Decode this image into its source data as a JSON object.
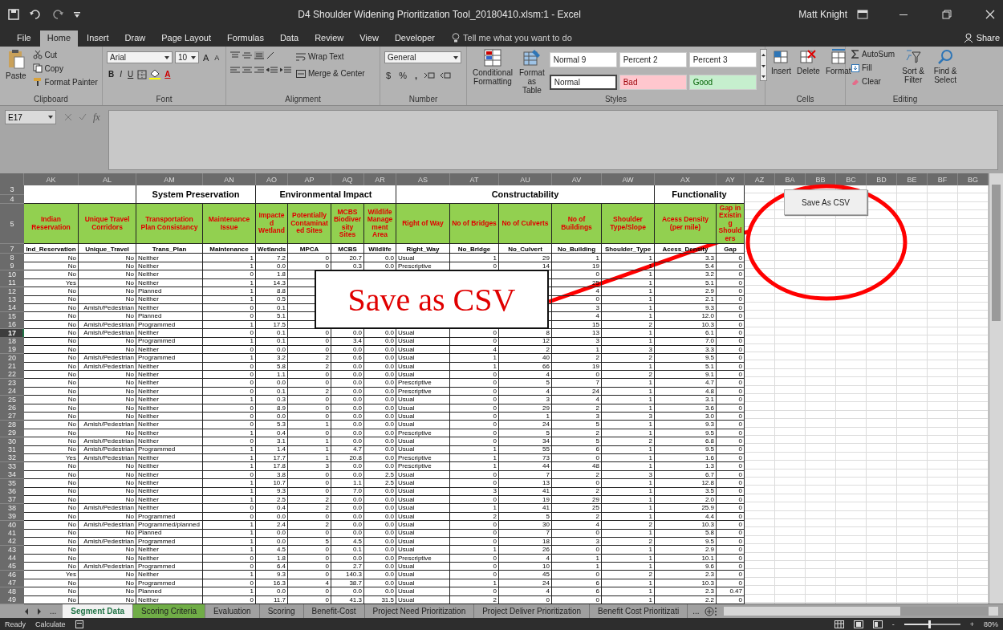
{
  "window": {
    "title": "D4 Shoulder Widening Prioritization Tool_20180410.xlsm:1  -  Excel",
    "user": "Matt Knight"
  },
  "ribbon_tabs": [
    {
      "label": "File",
      "selected": false
    },
    {
      "label": "Home",
      "selected": true
    },
    {
      "label": "Insert",
      "selected": false
    },
    {
      "label": "Draw",
      "selected": false
    },
    {
      "label": "Page Layout",
      "selected": false
    },
    {
      "label": "Formulas",
      "selected": false
    },
    {
      "label": "Data",
      "selected": false
    },
    {
      "label": "Review",
      "selected": false
    },
    {
      "label": "View",
      "selected": false
    },
    {
      "label": "Developer",
      "selected": false
    }
  ],
  "tell_me": {
    "placeholder": "Tell me what you want to do"
  },
  "share": "Share",
  "ribbon": {
    "clipboard": {
      "label": "Clipboard",
      "paste": "Paste",
      "cut": "Cut",
      "copy": "Copy",
      "format_painter": "Format Painter"
    },
    "font": {
      "label": "Font",
      "family": "Arial",
      "size": "10",
      "grow": "A",
      "shrink": "A",
      "bold": "B",
      "italic": "I",
      "underline": "U",
      "font_color_button": "A"
    },
    "alignment": {
      "label": "Alignment",
      "wrap_text": "Wrap Text",
      "merge_center": "Merge & Center"
    },
    "number": {
      "label": "Number",
      "format": "General",
      "currency": "$",
      "percent": "%",
      "comma": ","
    },
    "styles": {
      "label": "Styles",
      "conditional": "Conditional Formatting",
      "format_table": "Format as Table",
      "cells": [
        {
          "label": "Normal 9",
          "kind": "plain",
          "selected": false
        },
        {
          "label": "Percent 2",
          "kind": "plain",
          "selected": false
        },
        {
          "label": "Percent 3",
          "kind": "plain",
          "selected": false
        },
        {
          "label": "Normal",
          "kind": "plain",
          "selected": true
        },
        {
          "label": "Bad",
          "kind": "bad",
          "selected": false
        },
        {
          "label": "Good",
          "kind": "good",
          "selected": false
        }
      ]
    },
    "cells": {
      "label": "Cells",
      "insert": "Insert",
      "delete": "Delete",
      "format": "Format"
    },
    "editing": {
      "label": "Editing",
      "autosum": "AutoSum",
      "fill": "Fill",
      "clear": "Clear",
      "sort_filter": "Sort & Filter",
      "find_select": "Find & Select"
    }
  },
  "formula_bar": {
    "name_box": "E17",
    "function_label": "fx"
  },
  "sheet": {
    "column_letters": [
      "AK",
      "AL",
      "AM",
      "AN",
      "AO",
      "AP",
      "AQ",
      "AR",
      "AS",
      "AT",
      "AU",
      "AV",
      "AW",
      "AX",
      "AY",
      "AZ",
      "BA",
      "BB",
      "BC",
      "BD",
      "BE",
      "BF",
      "BG"
    ],
    "group_row_numbers": [
      "3",
      "4"
    ],
    "header_row_number": "5",
    "field_row_number": "7",
    "column_groups": [
      {
        "columns": [
          {
            "title": "Indian Reservation",
            "field": "Ind_Reservation"
          },
          {
            "title": "Unique Travel Corridors",
            "field": "Unique_Travel"
          }
        ]
      },
      {
        "label": "System Preservation",
        "columns": [
          {
            "title": "Transportation Plan Consistancy",
            "field": "Trans_Plan"
          },
          {
            "title": "Maintenance Issue",
            "field": "Maintenance"
          }
        ]
      },
      {
        "label": "Environmental Impact",
        "columns": [
          {
            "title": "Impacted Wetland",
            "field": "Wetlands"
          },
          {
            "title": "Potentially Contaminated Sites",
            "field": "MPCA"
          },
          {
            "title": "MCBS Biodiversity Sites",
            "field": "MCBS"
          },
          {
            "title": "Wildlife Management Area",
            "field": "Wildlife"
          }
        ]
      },
      {
        "label": "Constructability",
        "columns": [
          {
            "title": "Right of Way",
            "field": "Right_Way"
          },
          {
            "title": "No of Bridges",
            "field": "No_Bridge"
          },
          {
            "title": "No of Culverts",
            "field": "No_Culvert"
          },
          {
            "title": "No of Buildings",
            "field": "No_Building"
          },
          {
            "title": "Shoulder Type/Slope",
            "field": "Shoulder_Type"
          }
        ]
      },
      {
        "label": "Functionality",
        "columns": [
          {
            "title": "Acess Density (per mile)",
            "field": "Acess_Density"
          },
          {
            "title": "Gap in Existing Shoulders",
            "field": "Gap"
          }
        ]
      }
    ],
    "rows": [
      {
        "number": "8",
        "selected": false,
        "cells": [
          "No",
          "No",
          "Neither",
          "1",
          "7.2",
          "0",
          "20.7",
          "0.0",
          "Usual",
          "1",
          "29",
          "1",
          "1",
          "3.3",
          "0"
        ]
      },
      {
        "number": "9",
        "selected": false,
        "cells": [
          "No",
          "No",
          "Neither",
          "1",
          "0.0",
          "0",
          "0.3",
          "0.0",
          "Prescriptive",
          "0",
          "14",
          "19",
          "1",
          "5.4",
          "0"
        ]
      },
      {
        "number": "10",
        "selected": false,
        "cells": [
          "No",
          "No",
          "Neither",
          "0",
          "1.8",
          null,
          null,
          null,
          null,
          null,
          null,
          "0",
          "1",
          "3.2",
          "0"
        ]
      },
      {
        "number": "11",
        "selected": false,
        "cells": [
          "Yes",
          "No",
          "Neither",
          "1",
          "14.3",
          null,
          null,
          null,
          null,
          null,
          null,
          "25",
          "1",
          "5.1",
          "0"
        ]
      },
      {
        "number": "12",
        "selected": false,
        "cells": [
          "No",
          "No",
          "Planned",
          "1",
          "8.8",
          null,
          null,
          null,
          null,
          null,
          null,
          "4",
          "1",
          "2.9",
          "0"
        ]
      },
      {
        "number": "13",
        "selected": false,
        "cells": [
          "No",
          "No",
          "Neither",
          "1",
          "0.5",
          null,
          null,
          null,
          null,
          null,
          null,
          "0",
          "1",
          "2.1",
          "0"
        ]
      },
      {
        "number": "14",
        "selected": false,
        "cells": [
          "No",
          "Amish/Pedestrian",
          "Neither",
          "0",
          "0.1",
          null,
          null,
          null,
          null,
          null,
          null,
          "3",
          "1",
          "9.3",
          "0"
        ]
      },
      {
        "number": "15",
        "selected": false,
        "cells": [
          "No",
          "No",
          "Planned",
          "0",
          "5.1",
          null,
          null,
          null,
          null,
          null,
          null,
          "4",
          "1",
          "12.0",
          "0"
        ]
      },
      {
        "number": "16",
        "selected": false,
        "cells": [
          "No",
          "Amish/Pedestrian",
          "Programmed",
          "1",
          "17.5",
          null,
          null,
          null,
          null,
          null,
          null,
          "15",
          "2",
          "10.3",
          "0"
        ]
      },
      {
        "number": "17",
        "selected": true,
        "cells": [
          "No",
          "Amish/Pedestrian",
          "Neither",
          "0",
          "0.1",
          "0",
          "0.0",
          "0.0",
          "Usual",
          "0",
          "8",
          "13",
          "1",
          "6.1",
          "0"
        ]
      },
      {
        "number": "18",
        "selected": false,
        "cells": [
          "No",
          "No",
          "Programmed",
          "1",
          "0.1",
          "0",
          "3.4",
          "0.0",
          "Usual",
          "0",
          "12",
          "3",
          "1",
          "7.0",
          "0"
        ]
      },
      {
        "number": "19",
        "selected": false,
        "cells": [
          "No",
          "No",
          "Neither",
          "0",
          "0.0",
          "0",
          "0.0",
          "0.0",
          "Usual",
          "4",
          "2",
          "1",
          "3",
          "3.3",
          "0"
        ]
      },
      {
        "number": "20",
        "selected": false,
        "cells": [
          "No",
          "Amish/Pedestrian",
          "Programmed",
          "1",
          "3.2",
          "2",
          "0.6",
          "0.0",
          "Usual",
          "1",
          "40",
          "2",
          "2",
          "9.5",
          "0"
        ]
      },
      {
        "number": "21",
        "selected": false,
        "cells": [
          "No",
          "Amish/Pedestrian",
          "Neither",
          "0",
          "5.8",
          "2",
          "0.0",
          "0.0",
          "Usual",
          "1",
          "66",
          "19",
          "1",
          "5.1",
          "0"
        ]
      },
      {
        "number": "22",
        "selected": false,
        "cells": [
          "No",
          "No",
          "Neither",
          "0",
          "1.1",
          "0",
          "0.0",
          "0.0",
          "Usual",
          "0",
          "4",
          "0",
          "2",
          "9.1",
          "0"
        ]
      },
      {
        "number": "23",
        "selected": false,
        "cells": [
          "No",
          "No",
          "Neither",
          "0",
          "0.0",
          "0",
          "0.0",
          "0.0",
          "Prescriptive",
          "0",
          "5",
          "7",
          "1",
          "4.7",
          "0"
        ]
      },
      {
        "number": "24",
        "selected": false,
        "cells": [
          "No",
          "No",
          "Neither",
          "0",
          "0.1",
          "2",
          "0.0",
          "0.0",
          "Prescriptive",
          "0",
          "4",
          "24",
          "1",
          "4.8",
          "0"
        ]
      },
      {
        "number": "25",
        "selected": false,
        "cells": [
          "No",
          "No",
          "Neither",
          "1",
          "0.3",
          "0",
          "0.0",
          "0.0",
          "Usual",
          "0",
          "3",
          "4",
          "1",
          "3.1",
          "0"
        ]
      },
      {
        "number": "26",
        "selected": false,
        "cells": [
          "No",
          "No",
          "Neither",
          "0",
          "8.9",
          "0",
          "0.0",
          "0.0",
          "Usual",
          "0",
          "29",
          "2",
          "1",
          "3.6",
          "0"
        ]
      },
      {
        "number": "27",
        "selected": false,
        "cells": [
          "No",
          "No",
          "Neither",
          "0",
          "0.0",
          "0",
          "0.0",
          "0.0",
          "Usual",
          "0",
          "1",
          "3",
          "3",
          "3.0",
          "0"
        ]
      },
      {
        "number": "28",
        "selected": false,
        "cells": [
          "No",
          "Amish/Pedestrian",
          "Neither",
          "0",
          "5.3",
          "1",
          "0.0",
          "0.0",
          "Usual",
          "0",
          "24",
          "5",
          "1",
          "9.3",
          "0"
        ]
      },
      {
        "number": "29",
        "selected": false,
        "cells": [
          "No",
          "No",
          "Neither",
          "1",
          "0.4",
          "0",
          "0.0",
          "0.0",
          "Prescriptive",
          "0",
          "5",
          "2",
          "1",
          "9.5",
          "0"
        ]
      },
      {
        "number": "30",
        "selected": false,
        "cells": [
          "No",
          "Amish/Pedestrian",
          "Neither",
          "0",
          "3.1",
          "1",
          "0.0",
          "0.0",
          "Usual",
          "0",
          "34",
          "5",
          "2",
          "6.8",
          "0"
        ]
      },
      {
        "number": "31",
        "selected": false,
        "cells": [
          "No",
          "Amish/Pedestrian",
          "Programmed",
          "1",
          "1.4",
          "1",
          "4.7",
          "0.0",
          "Usual",
          "1",
          "55",
          "6",
          "1",
          "9.5",
          "0"
        ]
      },
      {
        "number": "32",
        "selected": false,
        "cells": [
          "Yes",
          "Amish/Pedestrian",
          "Neither",
          "1",
          "17.7",
          "1",
          "20.8",
          "0.0",
          "Prescriptive",
          "1",
          "73",
          "0",
          "1",
          "1.6",
          "0"
        ]
      },
      {
        "number": "33",
        "selected": false,
        "cells": [
          "No",
          "No",
          "Neither",
          "1",
          "17.8",
          "3",
          "0.0",
          "0.0",
          "Prescriptive",
          "1",
          "44",
          "48",
          "1",
          "1.3",
          "0"
        ]
      },
      {
        "number": "34",
        "selected": false,
        "cells": [
          "No",
          "No",
          "Neither",
          "0",
          "3.8",
          "0",
          "0.0",
          "2.5",
          "Usual",
          "0",
          "7",
          "2",
          "3",
          "6.7",
          "0"
        ]
      },
      {
        "number": "35",
        "selected": false,
        "cells": [
          "No",
          "No",
          "Neither",
          "1",
          "10.7",
          "0",
          "1.1",
          "2.5",
          "Usual",
          "0",
          "13",
          "0",
          "1",
          "12.8",
          "0"
        ]
      },
      {
        "number": "36",
        "selected": false,
        "cells": [
          "No",
          "No",
          "Neither",
          "1",
          "9.3",
          "0",
          "7.0",
          "0.0",
          "Usual",
          "3",
          "41",
          "2",
          "1",
          "3.5",
          "0"
        ]
      },
      {
        "number": "37",
        "selected": false,
        "cells": [
          "No",
          "No",
          "Neither",
          "1",
          "2.5",
          "2",
          "0.0",
          "0.0",
          "Usual",
          "0",
          "19",
          "29",
          "1",
          "2.0",
          "0"
        ]
      },
      {
        "number": "38",
        "selected": false,
        "cells": [
          "No",
          "Amish/Pedestrian",
          "Neither",
          "0",
          "0.4",
          "2",
          "0.0",
          "0.0",
          "Usual",
          "1",
          "41",
          "25",
          "1",
          "25.9",
          "0"
        ]
      },
      {
        "number": "39",
        "selected": false,
        "cells": [
          "No",
          "No",
          "Programmed",
          "0",
          "0.0",
          "0",
          "0.0",
          "0.0",
          "Usual",
          "2",
          "5",
          "2",
          "1",
          "4.4",
          "0"
        ]
      },
      {
        "number": "40",
        "selected": false,
        "cells": [
          "No",
          "Amish/Pedestrian",
          "Programmed/planned",
          "1",
          "2.4",
          "2",
          "0.0",
          "0.0",
          "Usual",
          "0",
          "30",
          "4",
          "2",
          "10.3",
          "0"
        ]
      },
      {
        "number": "41",
        "selected": false,
        "cells": [
          "No",
          "No",
          "Planned",
          "1",
          "0.0",
          "0",
          "0.0",
          "0.0",
          "Usual",
          "0",
          "7",
          "0",
          "1",
          "5.8",
          "0"
        ]
      },
      {
        "number": "42",
        "selected": false,
        "cells": [
          "No",
          "Amish/Pedestrian",
          "Programmed",
          "1",
          "0.0",
          "5",
          "4.5",
          "0.0",
          "Usual",
          "0",
          "18",
          "3",
          "2",
          "9.5",
          "0"
        ]
      },
      {
        "number": "43",
        "selected": false,
        "cells": [
          "No",
          "No",
          "Neither",
          "1",
          "4.5",
          "0",
          "0.1",
          "0.0",
          "Usual",
          "1",
          "26",
          "0",
          "1",
          "2.9",
          "0"
        ]
      },
      {
        "number": "44",
        "selected": false,
        "cells": [
          "No",
          "No",
          "Neither",
          "0",
          "1.8",
          "0",
          "0.0",
          "0.0",
          "Prescriptive",
          "0",
          "4",
          "1",
          "1",
          "10.1",
          "0"
        ]
      },
      {
        "number": "45",
        "selected": false,
        "cells": [
          "No",
          "Amish/Pedestrian",
          "Programmed",
          "0",
          "6.4",
          "0",
          "2.7",
          "0.0",
          "Usual",
          "0",
          "10",
          "1",
          "1",
          "9.6",
          "0"
        ]
      },
      {
        "number": "46",
        "selected": false,
        "cells": [
          "Yes",
          "No",
          "Neither",
          "1",
          "9.3",
          "0",
          "140.3",
          "0.0",
          "Usual",
          "0",
          "45",
          "0",
          "2",
          "2.3",
          "0"
        ]
      },
      {
        "number": "47",
        "selected": false,
        "cells": [
          "No",
          "No",
          "Programmed",
          "0",
          "16.3",
          "4",
          "38.7",
          "0.0",
          "Usual",
          "1",
          "24",
          "6",
          "1",
          "10.3",
          "0"
        ]
      },
      {
        "number": "48",
        "selected": false,
        "cells": [
          "No",
          "No",
          "Planned",
          "1",
          "0.0",
          "0",
          "0.0",
          "0.0",
          "Usual",
          "0",
          "4",
          "6",
          "1",
          "2.3",
          "0.47"
        ]
      },
      {
        "number": "49",
        "selected": false,
        "cells": [
          "No",
          "No",
          "Neither",
          "0",
          "11.7",
          "0",
          "41.3",
          "31.5",
          "Usual",
          "2",
          "0",
          "0",
          "1",
          "2.2",
          "0"
        ]
      }
    ],
    "button": "Save As CSV",
    "callout": "Save as CSV"
  },
  "sheet_tabs": {
    "more_left": "...",
    "tabs": [
      {
        "label": "Segment Data",
        "selected": true
      },
      {
        "label": "Scoring Criteria",
        "selected": false,
        "color": "#70ad47"
      },
      {
        "label": "Evaluation",
        "selected": false
      },
      {
        "label": "Scoring",
        "selected": false
      },
      {
        "label": "Benefit-Cost",
        "selected": false
      },
      {
        "label": "Project Need Prioritization",
        "selected": false
      },
      {
        "label": "Project Deliver Prioritization",
        "selected": false
      },
      {
        "label": "Benefit Cost Prioritizati",
        "selected": false
      }
    ],
    "more_right": "..."
  },
  "status_bar": {
    "state": "Ready",
    "mode": "Calculate",
    "zoom": "80%",
    "zoom_out": "-",
    "zoom_in": "+",
    "zoom_slider": {
      "level": 0.45
    }
  }
}
